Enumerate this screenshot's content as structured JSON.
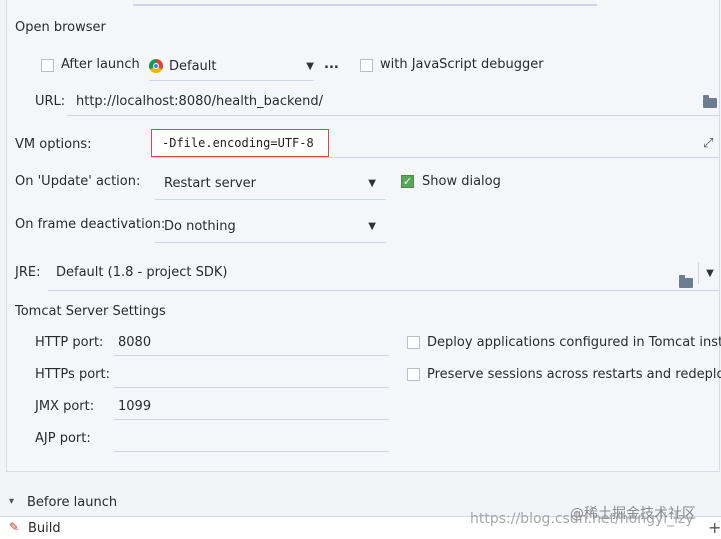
{
  "open_browser": {
    "title": "Open browser",
    "after_launch_label": "After launch",
    "browser_value": "Default",
    "more_button": "...",
    "js_debugger_label": "with JavaScript debugger",
    "url_label": "URL:",
    "url_value": "http://localhost:8080/health_backend/"
  },
  "vm_options": {
    "label": "VM options:",
    "value": "-Dfile.encoding=UTF-8"
  },
  "update_action": {
    "label": "On 'Update' action:",
    "value": "Restart server",
    "show_dialog_label": "Show dialog",
    "show_dialog_checked": true
  },
  "frame_deactivation": {
    "label": "On frame deactivation:",
    "value": "Do nothing"
  },
  "jre": {
    "label": "JRE:",
    "value": "Default (1.8 - project SDK)"
  },
  "tomcat": {
    "title": "Tomcat Server Settings",
    "http_port_label": "HTTP port:",
    "http_port_value": "8080",
    "https_port_label": "HTTPs port:",
    "https_port_value": "",
    "jmx_port_label": "JMX port:",
    "jmx_port_value": "1099",
    "ajp_port_label": "AJP port:",
    "ajp_port_value": "",
    "deploy_label": "Deploy applications configured in Tomcat instance",
    "preserve_label": "Preserve sessions across restarts and redeploys"
  },
  "before_launch": {
    "title": "Before launch",
    "items": [
      {
        "label": "Build"
      }
    ],
    "add_button": "+"
  },
  "watermark": {
    "url": "https://blog.csdn.net/hongyi_lzy",
    "site": "@稀土掘金技术社区"
  },
  "icons": {
    "browser": "chrome-icon",
    "folder": "folder-icon",
    "expand": "expand-icon",
    "build": "hammer-icon"
  }
}
